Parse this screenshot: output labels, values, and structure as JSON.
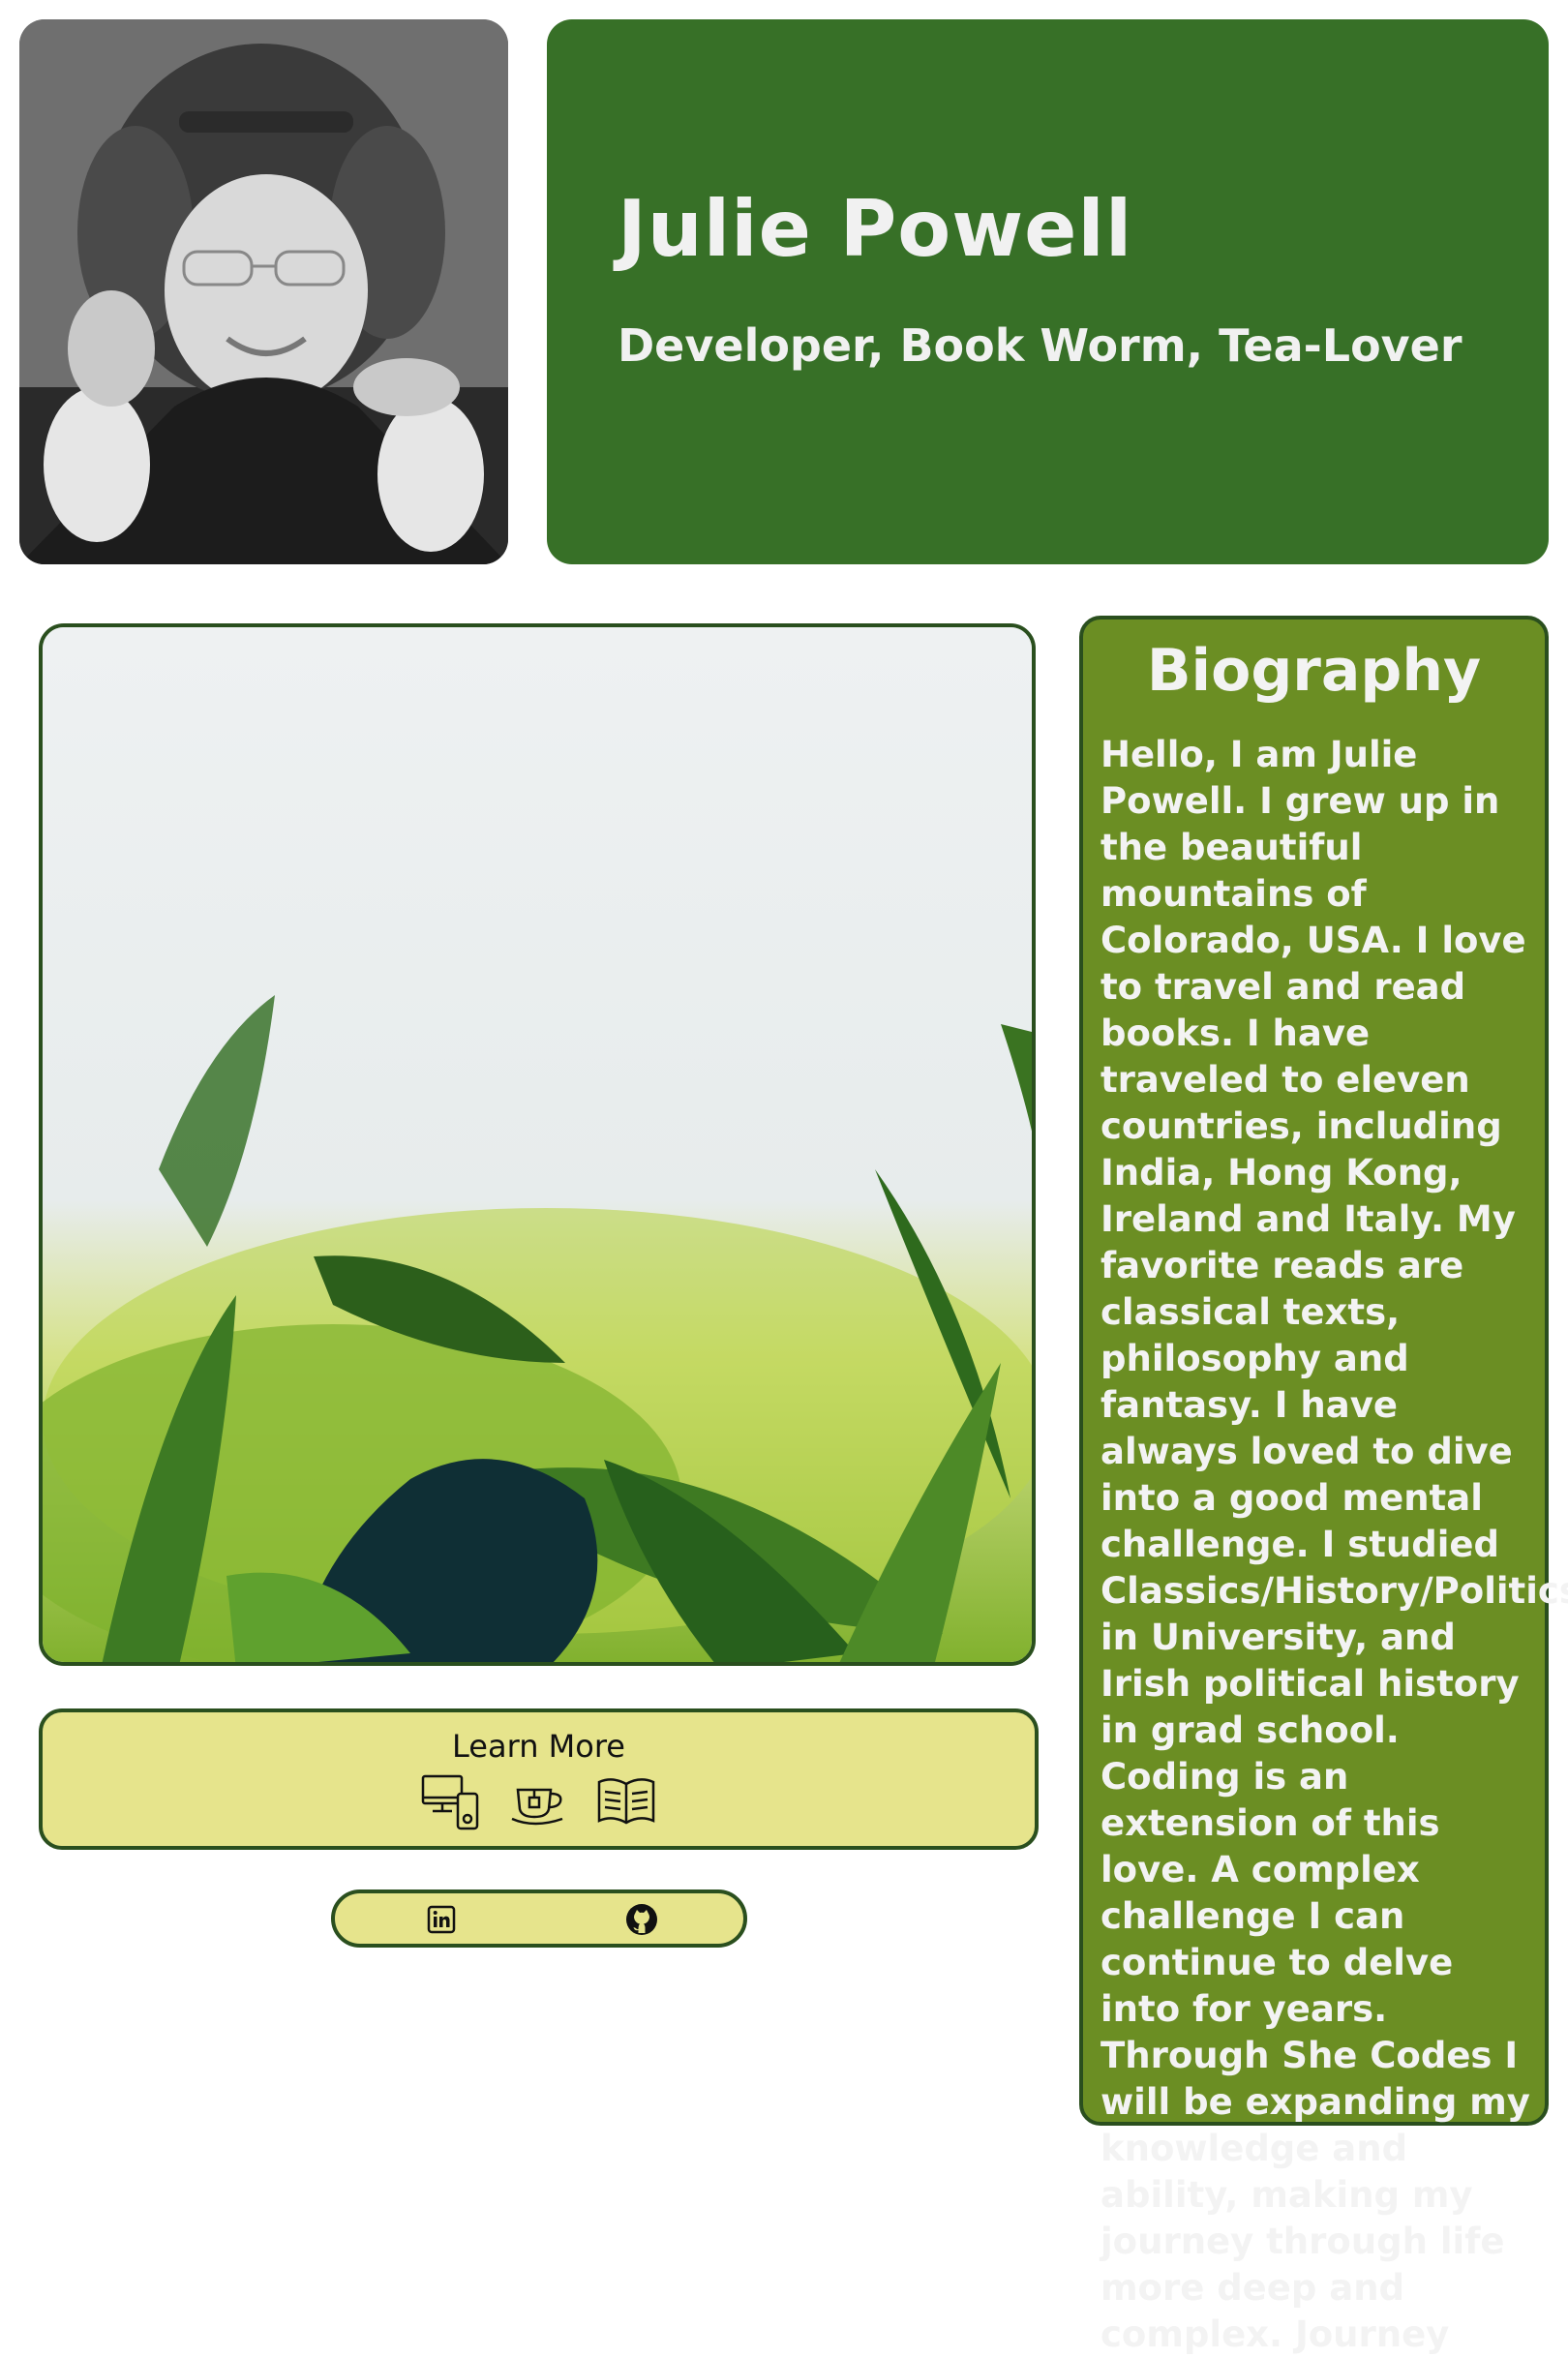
{
  "header": {
    "name": "Julie Powell",
    "tagline": "Developer, Book Worm, Tea-Lover"
  },
  "learn_more": {
    "label": "Learn More",
    "icons": [
      "devices-icon",
      "tea-cup-icon",
      "open-book-icon"
    ]
  },
  "social": {
    "icons": [
      "linkedin-icon",
      "github-icon"
    ]
  },
  "biography": {
    "title": "Biography",
    "text": "Hello, I am Julie Powell. I grew up in the beautiful mountains of Colorado, USA. I love to travel and read books. I have traveled to eleven countries, including India, Hong Kong, Ireland and Italy. My favorite reads are classical texts, philosophy and fantasy. I have always loved to dive into a good mental challenge. I studied Classics/History/Politics in University, and Irish political history in grad school. Coding is an extension of this love. A complex challenge I can continue to delve into for years. Through She Codes I will be expanding my knowledge and ability, making my journey through life more deep and complex. Journey"
  },
  "colors": {
    "header_bg": "#377027",
    "bio_bg": "#6b8e23",
    "accent_yellow": "#e6e48c",
    "border_dark": "#2a4f1e"
  }
}
